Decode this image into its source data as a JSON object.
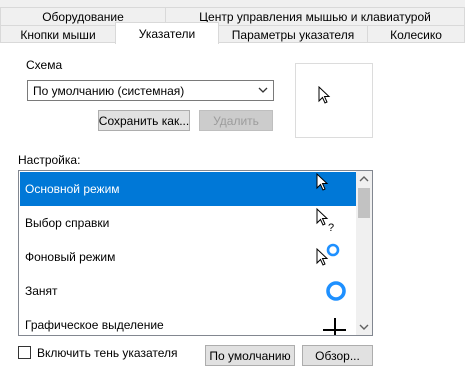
{
  "tabs_back": [
    "Оборудование",
    "Центр управления мышью и клавиатурой"
  ],
  "tabs_front": [
    "Кнопки мыши",
    "Указатели",
    "Параметры указателя",
    "Колесико"
  ],
  "scheme": {
    "legend": "Схема",
    "selected": "По умолчанию (системная)",
    "save_label": "Сохранить как...",
    "delete_label": "Удалить"
  },
  "customize_label": "Настройка:",
  "cursors": [
    {
      "label": "Основной режим",
      "icon": "arrow-cursor-icon",
      "selected": true
    },
    {
      "label": "Выбор справки",
      "icon": "help-select-cursor-icon",
      "selected": false
    },
    {
      "label": "Фоновый режим",
      "icon": "working-in-background-cursor-icon",
      "selected": false
    },
    {
      "label": "Занят",
      "icon": "busy-cursor-icon",
      "selected": false
    },
    {
      "label": "Графическое выделение",
      "icon": "precision-select-cursor-icon",
      "selected": false
    }
  ],
  "shadow_checkbox": {
    "label": "Включить тень указателя",
    "checked": false
  },
  "default_label": "По умолчанию",
  "browse_label": "Обзор...",
  "colors": {
    "accent": "#0078d7",
    "busy_ring": "#1e90ff"
  }
}
